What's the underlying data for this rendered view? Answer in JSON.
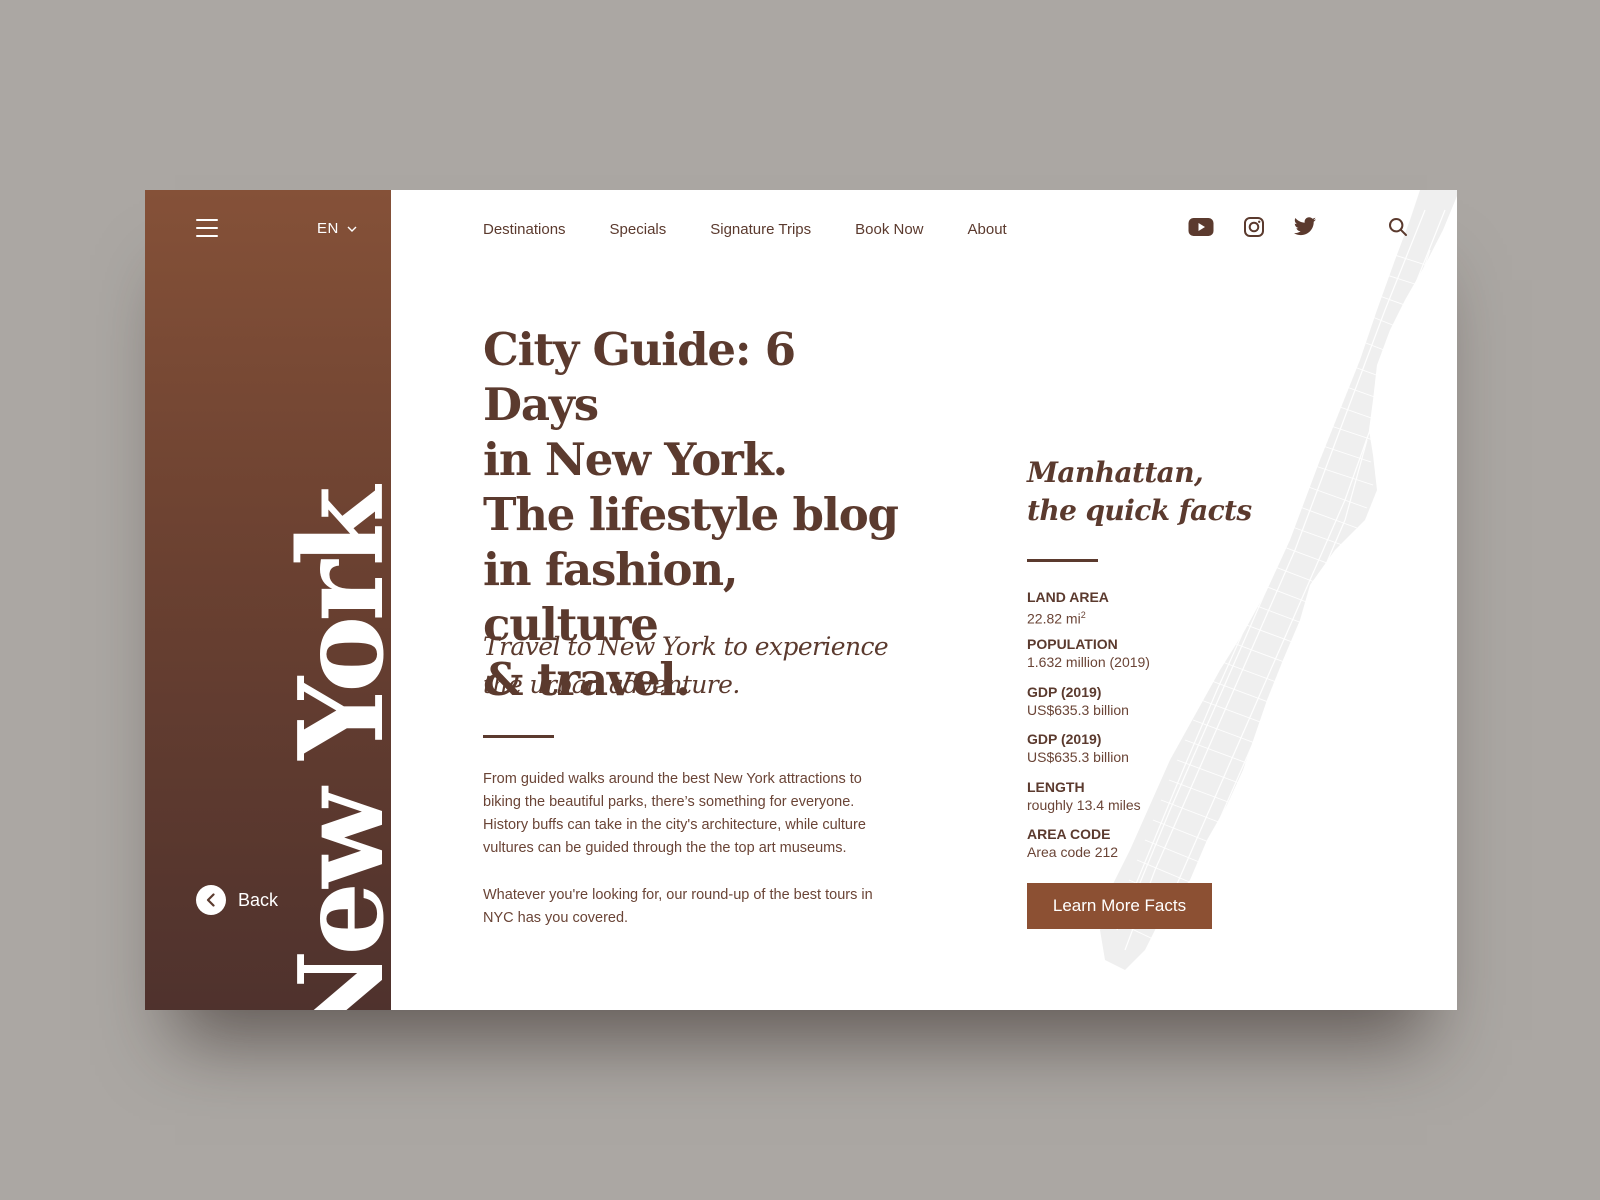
{
  "sidebar": {
    "language": "EN",
    "vertical_title": "New York",
    "back_label": "Back"
  },
  "nav": {
    "items": [
      {
        "label": "Destinations"
      },
      {
        "label": "Specials"
      },
      {
        "label": "Signature Trips"
      },
      {
        "label": "Book Now"
      },
      {
        "label": "About"
      }
    ]
  },
  "header_icons": [
    "youtube-icon",
    "instagram-icon",
    "twitter-icon",
    "search-icon"
  ],
  "main": {
    "headline": "City Guide: 6 Days in New York. The lifestyle blog in fashion, culture & travel.",
    "headline_lines": [
      "City Guide: 6 Days",
      "in New York.",
      "The lifestyle blog",
      "in fashion, culture",
      "& travel."
    ],
    "subhead_lines": [
      "Travel to New York to experience",
      "the urban adventure."
    ],
    "paragraph1": "From guided walks around the best New York attractions to biking the beautiful parks, there’s something for everyone. History buffs can take in the city's architecture, while culture vultures can be guided through the the top art museums.",
    "paragraph2": "Whatever you're looking for, our round-up of the best tours in NYC has you covered."
  },
  "facts": {
    "title_lines": [
      "Manhattan,",
      "the quick facts"
    ],
    "items": [
      {
        "label": "LAND AREA",
        "value": "22.82 mi",
        "sup": "2"
      },
      {
        "label": "POPULATION",
        "value": "1.632 million (2019)"
      },
      {
        "label": "GDP (2019)",
        "value": "US$635.3 billion"
      },
      {
        "label": "GDP (2019)",
        "value": "US$635.3 billion"
      },
      {
        "label": "LENGTH",
        "value": "roughly 13.4 miles"
      },
      {
        "label": "AREA CODE",
        "value": "Area code 212"
      }
    ],
    "cta_label": "Learn More Facts"
  },
  "colors": {
    "page_bg": "#aba7a3",
    "sidebar_top": "#855138",
    "sidebar_bottom": "#4f322d",
    "text_brown": "#5b3a2e",
    "button_brown": "#8c5033"
  }
}
